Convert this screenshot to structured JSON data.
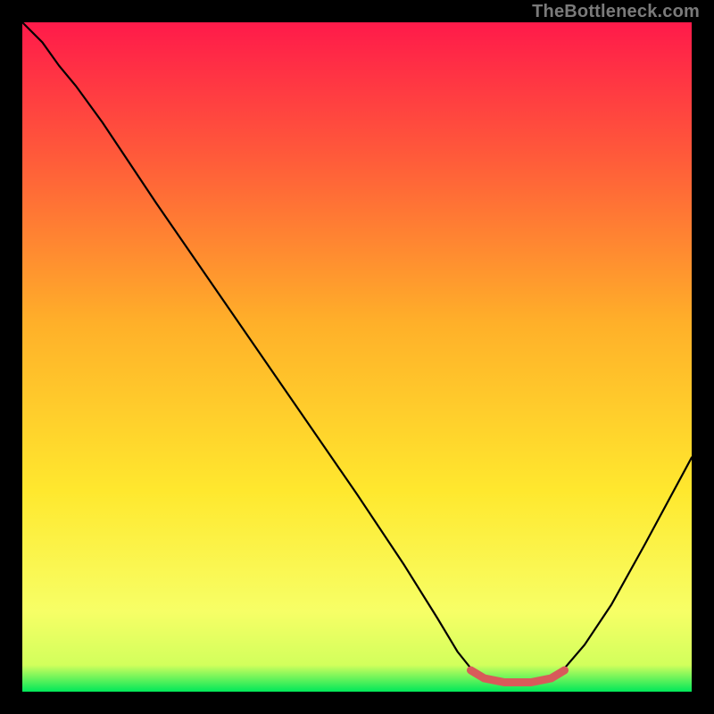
{
  "watermark": "TheBottleneck.com",
  "chart_data": {
    "type": "line",
    "title": "",
    "xlabel": "",
    "ylabel": "",
    "xlim": [
      0,
      100
    ],
    "ylim": [
      0,
      100
    ],
    "gradient_stops": [
      {
        "offset": 0.0,
        "color": "#ff1a4a"
      },
      {
        "offset": 0.2,
        "color": "#ff5a3a"
      },
      {
        "offset": 0.45,
        "color": "#ffb029"
      },
      {
        "offset": 0.7,
        "color": "#ffe82e"
      },
      {
        "offset": 0.88,
        "color": "#f7ff66"
      },
      {
        "offset": 0.96,
        "color": "#d2ff5c"
      },
      {
        "offset": 1.0,
        "color": "#00e85a"
      }
    ],
    "series": [
      {
        "name": "bottleneck-curve",
        "color": "#000000",
        "points": [
          {
            "x": 0.0,
            "y": 100.0
          },
          {
            "x": 3.0,
            "y": 97.0
          },
          {
            "x": 5.5,
            "y": 93.5
          },
          {
            "x": 8.0,
            "y": 90.5
          },
          {
            "x": 12.0,
            "y": 85.0
          },
          {
            "x": 20.0,
            "y": 73.0
          },
          {
            "x": 30.0,
            "y": 58.5
          },
          {
            "x": 40.0,
            "y": 44.0
          },
          {
            "x": 50.0,
            "y": 29.5
          },
          {
            "x": 57.0,
            "y": 19.0
          },
          {
            "x": 62.0,
            "y": 11.0
          },
          {
            "x": 65.0,
            "y": 6.0
          },
          {
            "x": 67.0,
            "y": 3.5
          },
          {
            "x": 69.0,
            "y": 2.0
          },
          {
            "x": 72.0,
            "y": 1.2
          },
          {
            "x": 76.0,
            "y": 1.2
          },
          {
            "x": 79.0,
            "y": 2.0
          },
          {
            "x": 81.0,
            "y": 3.5
          },
          {
            "x": 84.0,
            "y": 7.0
          },
          {
            "x": 88.0,
            "y": 13.0
          },
          {
            "x": 93.0,
            "y": 22.0
          },
          {
            "x": 100.0,
            "y": 35.0
          }
        ]
      }
    ],
    "highlight": {
      "name": "optimal-zone",
      "color": "#d85a5a",
      "points": [
        {
          "x": 67.0,
          "y": 3.2
        },
        {
          "x": 69.0,
          "y": 2.0
        },
        {
          "x": 72.0,
          "y": 1.4
        },
        {
          "x": 76.0,
          "y": 1.4
        },
        {
          "x": 79.0,
          "y": 2.0
        },
        {
          "x": 81.0,
          "y": 3.2
        }
      ]
    }
  }
}
